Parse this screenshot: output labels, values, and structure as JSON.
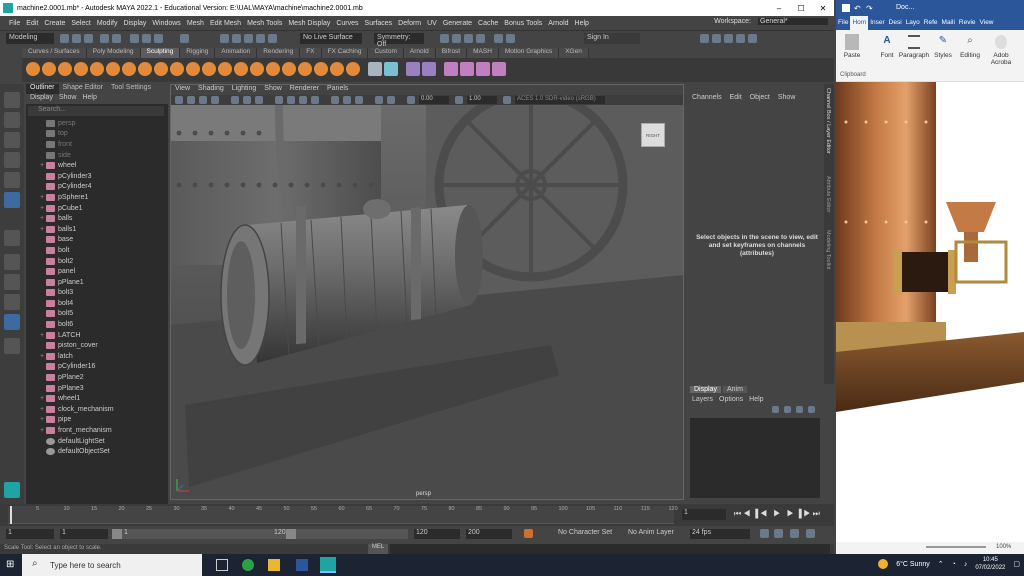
{
  "maya": {
    "title": "machine2.0001.mb* - Autodesk MAYA 2022.1 - Educational Version: E:\\UAL\\MAYA\\machine\\machine2.0001.mb",
    "menu": [
      "File",
      "Edit",
      "Create",
      "Select",
      "Modify",
      "Display",
      "Windows",
      "Mesh",
      "Edit Mesh",
      "Mesh Tools",
      "Mesh Display",
      "Curves",
      "Surfaces",
      "Deform",
      "UV",
      "Generate",
      "Cache",
      "Bonus Tools",
      "Arnold",
      "Help"
    ],
    "workspace_label": "Workspace:",
    "workspace_value": "General*",
    "status": {
      "mode": "Modeling",
      "live": "No Live Surface",
      "symmetry": "Symmetry: Off",
      "signin": "Sign In"
    },
    "shelf_tabs": [
      "Curves / Surfaces",
      "Poly Modeling",
      "Sculpting",
      "Rigging",
      "Animation",
      "Rendering",
      "FX",
      "FX Caching",
      "Custom",
      "Arnold",
      "Bifrost",
      "MASH",
      "Motion Graphics",
      "XGen"
    ],
    "shelf_active": "Sculpting",
    "outliner": {
      "tabs": [
        "Outliner",
        "Shape Editor",
        "Tool Settings"
      ],
      "menu": [
        "Display",
        "Show",
        "Help"
      ],
      "search_placeholder": "Search...",
      "items": [
        {
          "name": "persp",
          "type": "cam",
          "exp": false,
          "dim": true
        },
        {
          "name": "top",
          "type": "cam",
          "exp": false,
          "dim": true
        },
        {
          "name": "front",
          "type": "cam",
          "exp": false,
          "dim": true
        },
        {
          "name": "side",
          "type": "cam",
          "exp": false,
          "dim": true
        },
        {
          "name": "wheel",
          "type": "mesh",
          "exp": true
        },
        {
          "name": "pCylinder3",
          "type": "mesh",
          "exp": false
        },
        {
          "name": "pCylinder4",
          "type": "mesh",
          "exp": false
        },
        {
          "name": "pSphere1",
          "type": "mesh",
          "exp": true
        },
        {
          "name": "pCube1",
          "type": "mesh",
          "exp": true
        },
        {
          "name": "balls",
          "type": "mesh",
          "exp": true
        },
        {
          "name": "balls1",
          "type": "mesh",
          "exp": true
        },
        {
          "name": "base",
          "type": "mesh",
          "exp": false
        },
        {
          "name": "bolt",
          "type": "mesh",
          "exp": false
        },
        {
          "name": "bolt2",
          "type": "mesh",
          "exp": false
        },
        {
          "name": "panel",
          "type": "mesh",
          "exp": false
        },
        {
          "name": "pPlane1",
          "type": "mesh",
          "exp": false
        },
        {
          "name": "bolt3",
          "type": "mesh",
          "exp": false
        },
        {
          "name": "bolt4",
          "type": "mesh",
          "exp": false
        },
        {
          "name": "bolt5",
          "type": "mesh",
          "exp": false
        },
        {
          "name": "bolt6",
          "type": "mesh",
          "exp": false
        },
        {
          "name": "LATCH",
          "type": "mesh",
          "exp": true
        },
        {
          "name": "piston_cover",
          "type": "mesh",
          "exp": false
        },
        {
          "name": "latch",
          "type": "mesh",
          "exp": true
        },
        {
          "name": "pCylinder16",
          "type": "mesh",
          "exp": false
        },
        {
          "name": "pPlane2",
          "type": "mesh",
          "exp": false
        },
        {
          "name": "pPlane3",
          "type": "mesh",
          "exp": false
        },
        {
          "name": "wheel1",
          "type": "mesh",
          "exp": true
        },
        {
          "name": "clock_mechanism",
          "type": "mesh",
          "exp": true
        },
        {
          "name": "pipe",
          "type": "mesh",
          "exp": true
        },
        {
          "name": "front_mechanism",
          "type": "mesh",
          "exp": true
        },
        {
          "name": "defaultLightSet",
          "type": "set",
          "exp": false
        },
        {
          "name": "defaultObjectSet",
          "type": "set",
          "exp": false
        }
      ]
    },
    "viewport": {
      "menu": [
        "View",
        "Shading",
        "Lighting",
        "Show",
        "Renderer",
        "Panels"
      ],
      "field1": "0.00",
      "field2": "1.00",
      "colorspace": "ACES 1.0 SDR-video (sRGB)",
      "camera_label": "persp",
      "cube_label": "RIGHT"
    },
    "channel_box": {
      "menu": [
        "Channels",
        "Edit",
        "Object",
        "Show"
      ],
      "message": "Select objects in the scene to view, edit and set keyframes on channels (attributes)",
      "side_tabs": [
        "Channel Box / Layer Editor",
        "Attribute Editor",
        "Modeling Toolkit"
      ]
    },
    "layers": {
      "tabs": [
        "Display",
        "Anim"
      ],
      "menu": [
        "Layers",
        "Options",
        "Help"
      ]
    },
    "timeline": {
      "ticks": [
        "5",
        "10",
        "15",
        "20",
        "25",
        "30",
        "35",
        "40",
        "45",
        "50",
        "55",
        "60",
        "65",
        "70",
        "75",
        "80",
        "85",
        "90",
        "95",
        "100",
        "105",
        "110",
        "115",
        "120"
      ],
      "current": "1",
      "start": "1",
      "range_start": "1",
      "range_handle_start": "1",
      "range_handle_end": "120",
      "range_end": "120",
      "end": "200",
      "char_set": "No Character Set",
      "anim_layer": "No Anim Layer",
      "fps": "24 fps"
    },
    "cmdline": {
      "lang": "MEL",
      "help": "Scale Tool: Select an object to scale."
    }
  },
  "word": {
    "title": "Doc...",
    "tabs": [
      "File",
      "Hom",
      "Inser",
      "Desi",
      "Layo",
      "Refe",
      "Maili",
      "Revie",
      "View"
    ],
    "active_tab": "Hom",
    "groups": [
      "Paste",
      "Font",
      "Paragraph",
      "Styles",
      "Editing",
      "Adob Acroba"
    ],
    "clipboard": "Clipboard",
    "zoom": "100%"
  },
  "taskbar": {
    "search_placeholder": "Type here to search",
    "weather": "6°C  Sunny",
    "time": "10:45",
    "date": "07/02/2022"
  },
  "colors": {
    "maya_accent": "#1fa3a3",
    "word_blue": "#2b579a",
    "selection": "#3d6aa0"
  }
}
